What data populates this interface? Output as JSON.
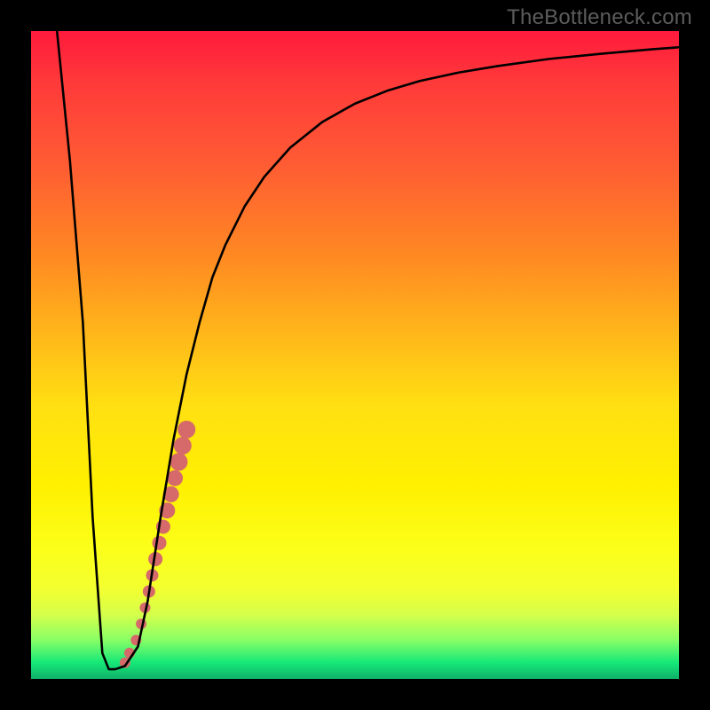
{
  "watermark": "TheBottleneck.com",
  "chart_data": {
    "type": "line",
    "title": "",
    "xlabel": "",
    "ylabel": "",
    "xlim": [
      0,
      100
    ],
    "ylim": [
      0,
      100
    ],
    "curve": {
      "x": [
        4,
        6,
        8,
        9.5,
        11,
        12,
        13,
        14.5,
        16.5,
        18,
        20,
        22,
        24,
        26,
        28,
        30,
        33,
        36,
        40,
        45,
        50,
        55,
        60,
        66,
        72,
        80,
        88,
        96,
        100
      ],
      "y": [
        100,
        80,
        55,
        25,
        4,
        1.5,
        1.5,
        2,
        5,
        12,
        25,
        37,
        47,
        55,
        62,
        67,
        73,
        77.5,
        82,
        86,
        88.8,
        90.8,
        92.3,
        93.6,
        94.6,
        95.7,
        96.5,
        97.2,
        97.5
      ]
    },
    "dots": {
      "color": "#d66a6a",
      "points": [
        {
          "x": 14.5,
          "y": 2.5,
          "r": 6
        },
        {
          "x": 15.2,
          "y": 4.0,
          "r": 6
        },
        {
          "x": 16.2,
          "y": 6.0,
          "r": 6
        },
        {
          "x": 17.0,
          "y": 8.5,
          "r": 6
        },
        {
          "x": 17.6,
          "y": 11.0,
          "r": 6
        },
        {
          "x": 18.2,
          "y": 13.5,
          "r": 7
        },
        {
          "x": 18.7,
          "y": 16.0,
          "r": 7
        },
        {
          "x": 19.2,
          "y": 18.5,
          "r": 8
        },
        {
          "x": 19.8,
          "y": 21.0,
          "r": 8
        },
        {
          "x": 20.4,
          "y": 23.5,
          "r": 8
        },
        {
          "x": 21.0,
          "y": 26.0,
          "r": 9
        },
        {
          "x": 21.6,
          "y": 28.5,
          "r": 9
        },
        {
          "x": 22.2,
          "y": 31.0,
          "r": 9
        },
        {
          "x": 22.8,
          "y": 33.5,
          "r": 10
        },
        {
          "x": 23.4,
          "y": 36.0,
          "r": 10
        },
        {
          "x": 24.0,
          "y": 38.5,
          "r": 10
        }
      ]
    },
    "gradient_stops": [
      {
        "pos": 0.0,
        "color": "#ff1a3c"
      },
      {
        "pos": 0.35,
        "color": "#ff8a22"
      },
      {
        "pos": 0.7,
        "color": "#fff000"
      },
      {
        "pos": 0.97,
        "color": "#15e878"
      },
      {
        "pos": 1.0,
        "color": "#0fb068"
      }
    ]
  }
}
